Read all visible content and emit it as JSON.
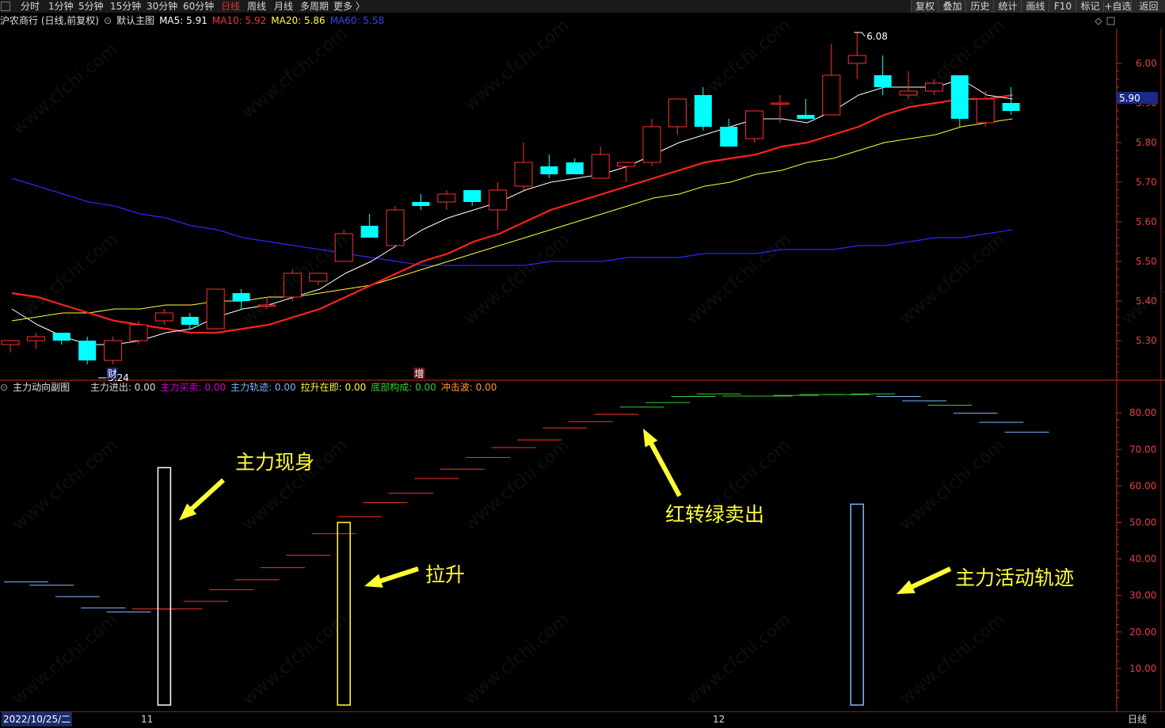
{
  "toolbar": {
    "periods": [
      "分时",
      "1分钟",
      "5分钟",
      "15分钟",
      "30分钟",
      "60分钟",
      "日线",
      "周线",
      "月线",
      "多周期",
      "更多 〉"
    ],
    "active_period": "日线",
    "right_buttons": [
      "复权",
      "叠加",
      "历史",
      "统计",
      "画线",
      "F10",
      "标记",
      "+自选",
      "返回"
    ]
  },
  "main_header": {
    "title": "沪农商行 (日线,前复权)",
    "template": "默认主图",
    "ma5": "MA5: 5.91",
    "ma10": "MA10: 5.92",
    "ma20": "MA20: 5.86",
    "ma60": "MA60: 5.58"
  },
  "sub_header": {
    "title": "主力动向副图",
    "items": [
      {
        "label": "主力进出: 0.00",
        "color": "#d8d8d8"
      },
      {
        "label": "主力买卖: 0.00",
        "color": "#d000d0"
      },
      {
        "label": "主力轨迹: 0.00",
        "color": "#7fb6ff"
      },
      {
        "label": "拉升在即: 0.00",
        "color": "#ffff33"
      },
      {
        "label": "底部构成: 0.00",
        "color": "#33cc33"
      },
      {
        "label": "冲击波: 0.00",
        "color": "#ff9933"
      }
    ]
  },
  "price_axis": [
    "6.00",
    "5.90",
    "5.80",
    "5.70",
    "5.60",
    "5.50",
    "5.40",
    "5.30"
  ],
  "price_tag": "5.90",
  "sub_axis": [
    "80.00",
    "70.00",
    "60.00",
    "50.00",
    "40.00",
    "30.00",
    "20.00",
    "10.00"
  ],
  "markers": {
    "high": "6.08",
    "low": "5.24",
    "event1": "财",
    "event2": "增"
  },
  "bottom": {
    "date": "2022/10/25/二",
    "month1": "11",
    "month2": "12",
    "period": "日线"
  },
  "annotations": {
    "a1": "主力现身",
    "a2": "拉升",
    "a3": "红转绿卖出",
    "a4": "主力活动轨迹"
  },
  "watermark": "www.cfchi.com",
  "colors": {
    "up": "#ff3030",
    "down": "#00ffff",
    "ma5": "#ffffff",
    "ma10": "#ff2020",
    "ma20": "#ffff33",
    "ma60": "#2020ff",
    "accent_red": "#8a1c1c"
  },
  "chart_data": {
    "type": "candlestick",
    "y_range": [
      5.2,
      6.12
    ],
    "candles": [
      {
        "o": 5.29,
        "h": 5.3,
        "l": 5.27,
        "c": 5.3
      },
      {
        "o": 5.3,
        "h": 5.32,
        "l": 5.28,
        "c": 5.31
      },
      {
        "o": 5.32,
        "h": 5.32,
        "l": 5.29,
        "c": 5.3
      },
      {
        "o": 5.3,
        "h": 5.31,
        "l": 5.24,
        "c": 5.25
      },
      {
        "o": 5.25,
        "h": 5.31,
        "l": 5.24,
        "c": 5.3
      },
      {
        "o": 5.3,
        "h": 5.35,
        "l": 5.29,
        "c": 5.34
      },
      {
        "o": 5.35,
        "h": 5.38,
        "l": 5.34,
        "c": 5.37
      },
      {
        "o": 5.36,
        "h": 5.37,
        "l": 5.33,
        "c": 5.34
      },
      {
        "o": 5.33,
        "h": 5.43,
        "l": 5.33,
        "c": 5.43
      },
      {
        "o": 5.42,
        "h": 5.43,
        "l": 5.38,
        "c": 5.4
      },
      {
        "o": 5.39,
        "h": 5.41,
        "l": 5.38,
        "c": 5.39
      },
      {
        "o": 5.41,
        "h": 5.48,
        "l": 5.4,
        "c": 5.47
      },
      {
        "o": 5.45,
        "h": 5.47,
        "l": 5.44,
        "c": 5.47
      },
      {
        "o": 5.5,
        "h": 5.58,
        "l": 5.5,
        "c": 5.57
      },
      {
        "o": 5.59,
        "h": 5.62,
        "l": 5.56,
        "c": 5.56
      },
      {
        "o": 5.54,
        "h": 5.64,
        "l": 5.54,
        "c": 5.63
      },
      {
        "o": 5.65,
        "h": 5.67,
        "l": 5.63,
        "c": 5.64
      },
      {
        "o": 5.65,
        "h": 5.68,
        "l": 5.63,
        "c": 5.67
      },
      {
        "o": 5.68,
        "h": 5.68,
        "l": 5.64,
        "c": 5.65
      },
      {
        "o": 5.63,
        "h": 5.7,
        "l": 5.58,
        "c": 5.68
      },
      {
        "o": 5.69,
        "h": 5.8,
        "l": 5.68,
        "c": 5.75
      },
      {
        "o": 5.74,
        "h": 5.77,
        "l": 5.71,
        "c": 5.72
      },
      {
        "o": 5.75,
        "h": 5.76,
        "l": 5.72,
        "c": 5.72
      },
      {
        "o": 5.71,
        "h": 5.79,
        "l": 5.71,
        "c": 5.77
      },
      {
        "o": 5.74,
        "h": 5.75,
        "l": 5.7,
        "c": 5.75
      },
      {
        "o": 5.75,
        "h": 5.86,
        "l": 5.74,
        "c": 5.84
      },
      {
        "o": 5.84,
        "h": 5.91,
        "l": 5.82,
        "c": 5.91
      },
      {
        "o": 5.92,
        "h": 5.94,
        "l": 5.83,
        "c": 5.84
      },
      {
        "o": 5.84,
        "h": 5.86,
        "l": 5.79,
        "c": 5.79
      },
      {
        "o": 5.81,
        "h": 5.88,
        "l": 5.8,
        "c": 5.88
      },
      {
        "o": 5.9,
        "h": 5.92,
        "l": 5.85,
        "c": 5.9
      },
      {
        "o": 5.87,
        "h": 5.91,
        "l": 5.86,
        "c": 5.86
      },
      {
        "o": 5.87,
        "h": 6.05,
        "l": 5.87,
        "c": 5.97
      },
      {
        "o": 6.0,
        "h": 6.08,
        "l": 5.96,
        "c": 6.02
      },
      {
        "o": 5.97,
        "h": 6.02,
        "l": 5.92,
        "c": 5.94
      },
      {
        "o": 5.92,
        "h": 5.98,
        "l": 5.91,
        "c": 5.93
      },
      {
        "o": 5.93,
        "h": 5.96,
        "l": 5.92,
        "c": 5.95
      },
      {
        "o": 5.97,
        "h": 5.97,
        "l": 5.84,
        "c": 5.86
      },
      {
        "o": 5.85,
        "h": 5.93,
        "l": 5.84,
        "c": 5.91
      },
      {
        "o": 5.9,
        "h": 5.94,
        "l": 5.87,
        "c": 5.88
      }
    ],
    "ma5": [
      5.38,
      5.34,
      5.31,
      5.29,
      5.29,
      5.3,
      5.32,
      5.33,
      5.36,
      5.38,
      5.39,
      5.41,
      5.43,
      5.47,
      5.5,
      5.54,
      5.58,
      5.61,
      5.63,
      5.65,
      5.68,
      5.7,
      5.71,
      5.72,
      5.74,
      5.77,
      5.8,
      5.82,
      5.84,
      5.86,
      5.86,
      5.85,
      5.88,
      5.92,
      5.94,
      5.94,
      5.94,
      5.96,
      5.92,
      5.91
    ],
    "ma10": [
      5.42,
      5.41,
      5.39,
      5.37,
      5.35,
      5.34,
      5.33,
      5.32,
      5.32,
      5.33,
      5.34,
      5.36,
      5.38,
      5.41,
      5.44,
      5.47,
      5.5,
      5.52,
      5.55,
      5.57,
      5.6,
      5.63,
      5.65,
      5.67,
      5.69,
      5.71,
      5.73,
      5.75,
      5.76,
      5.77,
      5.79,
      5.8,
      5.82,
      5.84,
      5.87,
      5.89,
      5.9,
      5.91,
      5.91,
      5.92
    ],
    "ma20": [
      5.35,
      5.36,
      5.37,
      5.37,
      5.38,
      5.38,
      5.39,
      5.39,
      5.4,
      5.4,
      5.41,
      5.41,
      5.42,
      5.43,
      5.44,
      5.46,
      5.48,
      5.5,
      5.52,
      5.54,
      5.56,
      5.58,
      5.6,
      5.62,
      5.64,
      5.66,
      5.67,
      5.69,
      5.7,
      5.72,
      5.73,
      5.75,
      5.76,
      5.78,
      5.8,
      5.81,
      5.82,
      5.84,
      5.85,
      5.86
    ],
    "ma60": [
      5.71,
      5.69,
      5.67,
      5.65,
      5.64,
      5.62,
      5.61,
      5.59,
      5.58,
      5.56,
      5.55,
      5.54,
      5.53,
      5.52,
      5.51,
      5.5,
      5.49,
      5.49,
      5.49,
      5.49,
      5.49,
      5.5,
      5.5,
      5.5,
      5.51,
      5.51,
      5.51,
      5.52,
      5.52,
      5.52,
      5.53,
      5.53,
      5.53,
      5.54,
      5.54,
      5.55,
      5.56,
      5.56,
      5.57,
      5.58
    ],
    "sub": {
      "y_range": [
        0,
        85
      ],
      "segments": [
        {
          "v": 33.7,
          "c": "#7fb6ff"
        },
        {
          "v": 32.8,
          "c": "#7fb6ff"
        },
        {
          "v": 29.7,
          "c": "#7fb6ff"
        },
        {
          "v": 26.6,
          "c": "#7fb6ff"
        },
        {
          "v": 25.5,
          "c": "#7fb6ff"
        },
        {
          "v": 26.3,
          "c": "#ff3030"
        },
        {
          "v": 26.3,
          "c": "#ff3030"
        },
        {
          "v": 28.4,
          "c": "#ff3030"
        },
        {
          "v": 31.6,
          "c": "#ff3030"
        },
        {
          "v": 34.3,
          "c": "#ff3030"
        },
        {
          "v": 37.6,
          "c": "#ff3030"
        },
        {
          "v": 41.0,
          "c": "#ff3030"
        },
        {
          "v": 46.9,
          "c": "#ff3030"
        },
        {
          "v": 51.6,
          "c": "#ff3030"
        },
        {
          "v": 55.4,
          "c": "#ff3030"
        },
        {
          "v": 58.0,
          "c": "#ff3030"
        },
        {
          "v": 62.0,
          "c": "#ff3030"
        },
        {
          "v": 64.6,
          "c": "#ff3030"
        },
        {
          "v": 67.8,
          "c": "#ff3030"
        },
        {
          "v": 70.5,
          "c": "#ff3030"
        },
        {
          "v": 72.6,
          "c": "#ff3030"
        },
        {
          "v": 75.9,
          "c": "#ff3030"
        },
        {
          "v": 77.6,
          "c": "#ff3030"
        },
        {
          "v": 79.6,
          "c": "#ff3030"
        },
        {
          "v": 81.6,
          "c": "#33cc33"
        },
        {
          "v": 82.8,
          "c": "#33cc33"
        },
        {
          "v": 84.5,
          "c": "#33cc33"
        },
        {
          "v": 85.2,
          "c": "#33cc33"
        },
        {
          "v": 84.6,
          "c": "#33cc33"
        },
        {
          "v": 84.6,
          "c": "#33cc33"
        },
        {
          "v": 84.8,
          "c": "#33cc33"
        },
        {
          "v": 85.0,
          "c": "#33cc33"
        },
        {
          "v": 85.0,
          "c": "#33cc33"
        },
        {
          "v": 85.2,
          "c": "#33cc33"
        },
        {
          "v": 84.5,
          "c": "#7fb6ff"
        },
        {
          "v": 83.3,
          "c": "#7fb6ff"
        },
        {
          "v": 82.1,
          "c": "#33cc33"
        },
        {
          "v": 79.9,
          "c": "#7fb6ff"
        },
        {
          "v": 77.4,
          "c": "#7fb6ff"
        },
        {
          "v": 74.7,
          "c": "#7fb6ff"
        }
      ],
      "bars": [
        {
          "i": 6,
          "v": 65,
          "c": "#ffffff"
        },
        {
          "i": 13,
          "v": 50,
          "c": "#ffff33"
        },
        {
          "i": 33,
          "v": 55,
          "c": "#7fb6ff"
        }
      ]
    }
  }
}
